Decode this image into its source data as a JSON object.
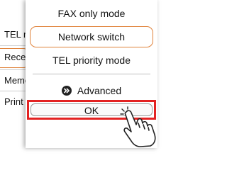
{
  "background": {
    "items": [
      "TEL nu",
      "Receiv",
      "Memo",
      "Print"
    ]
  },
  "menu": {
    "items": [
      "FAX only mode",
      "Network switch",
      "TEL priority mode"
    ],
    "selected_index": 1,
    "advanced_label": "Advanced",
    "ok_label": "OK"
  },
  "colors": {
    "selected_border": "#e0823a",
    "highlight_frame": "#e32222"
  },
  "icons": {
    "advanced": "double-chevron-icon",
    "pointer": "pointing-hand-icon"
  }
}
